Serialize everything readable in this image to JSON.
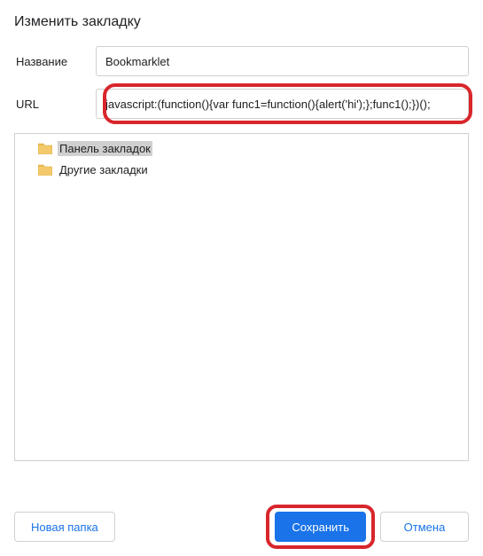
{
  "dialog": {
    "title": "Изменить закладку"
  },
  "fields": {
    "name_label": "Название",
    "name_value": "Bookmarklet",
    "url_label": "URL",
    "url_value": "javascript:(function(){var func1=function(){alert('hi');};func1();})();"
  },
  "folders": {
    "bookmarks_bar": "Панель закладок",
    "other_bookmarks": "Другие закладки"
  },
  "buttons": {
    "new_folder": "Новая папка",
    "save": "Сохранить",
    "cancel": "Отмена"
  }
}
